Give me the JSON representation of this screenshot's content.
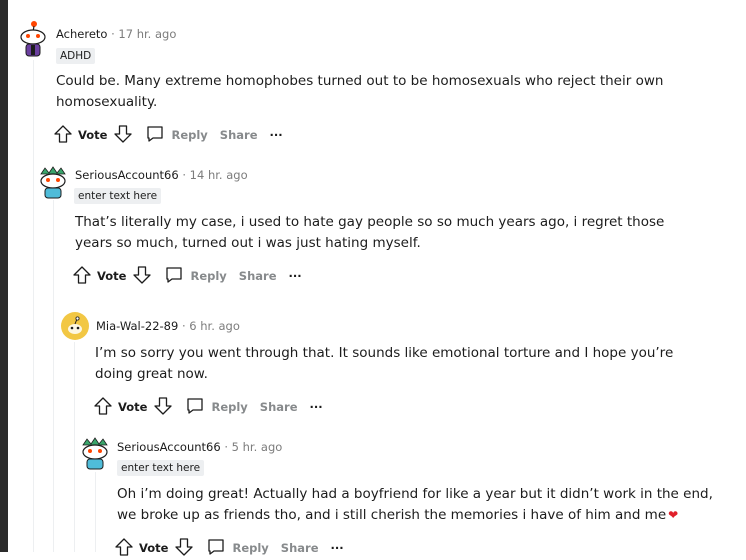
{
  "comments": [
    {
      "author": "Achereto",
      "sep": "·",
      "time": "17 hr. ago",
      "flair": "ADHD",
      "text": "Could be. Many extreme homophobes turned out to be homosexuals who reject their own homosexuality.",
      "vote": "Vote",
      "reply": "Reply",
      "share": "Share",
      "more": "···"
    },
    {
      "author": "SeriousAccount66",
      "sep": "·",
      "time": "14 hr. ago",
      "flair": "enter text here",
      "text": "That’s literally my case, i used to hate gay people so so much years ago, i regret those years so much, turned out i was just hating myself.",
      "vote": "Vote",
      "reply": "Reply",
      "share": "Share",
      "more": "···"
    },
    {
      "author": "Mia-Wal-22-89",
      "sep": "·",
      "time": "6 hr. ago",
      "flair": "",
      "text": "I’m so sorry you went through that. It sounds like emotional torture and I hope you’re doing great now.",
      "vote": "Vote",
      "reply": "Reply",
      "share": "Share",
      "more": "···"
    },
    {
      "author": "SeriousAccount66",
      "sep": "·",
      "time": "5 hr. ago",
      "flair": "enter text here",
      "text": "Oh i’m doing great! Actually had a boyfriend for like a year but it didn’t work in the end, we broke up as friends tho, and i still cherish the memories i have of him and me",
      "emoji": "❤",
      "vote": "Vote",
      "reply": "Reply",
      "share": "Share",
      "more": "···"
    }
  ],
  "colors": {
    "meta": "#7c7c7c",
    "flair_bg": "#edeff1",
    "heart": "#e0202a"
  }
}
